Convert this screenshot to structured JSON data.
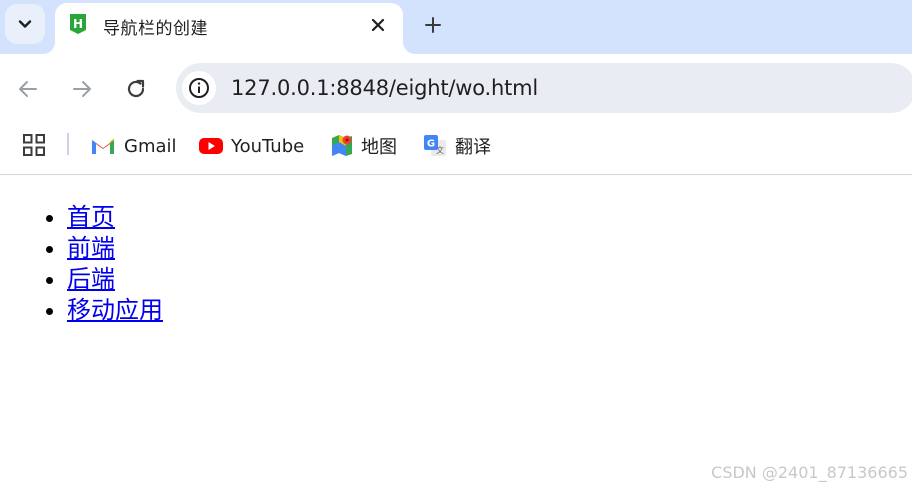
{
  "tab": {
    "title": "导航栏的创建",
    "favicon_letter": "H",
    "favicon_color": "#2aa53a"
  },
  "address_bar": {
    "url": "127.0.0.1:8848/eight/wo.html"
  },
  "bookmarks": [
    {
      "label": "Gmail",
      "icon": "gmail-icon"
    },
    {
      "label": "YouTube",
      "icon": "youtube-icon"
    },
    {
      "label": "地图",
      "icon": "maps-icon"
    },
    {
      "label": "翻译",
      "icon": "translate-icon"
    }
  ],
  "page": {
    "nav_items": [
      "首页",
      "前端",
      "后端",
      "移动应用"
    ],
    "link_color": "#0000ee"
  },
  "watermark": "CSDN @2401_87136665",
  "colors": {
    "tabstrip": "#d3e3fd",
    "omnibox": "#e9edf3",
    "youtube_red": "#ff0000"
  }
}
